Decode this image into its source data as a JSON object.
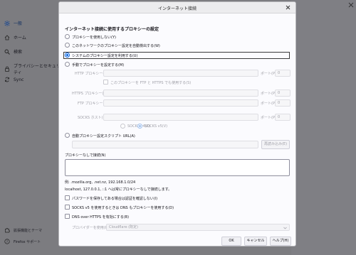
{
  "background": {
    "sidebar": {
      "items": [
        {
          "label": "一般",
          "icon": "gear-icon",
          "active": true
        },
        {
          "label": "ホーム",
          "icon": "home-icon"
        },
        {
          "label": "検索",
          "icon": "search-icon"
        },
        {
          "label": "プライバシーとセキュリティ",
          "icon": "lock-icon"
        },
        {
          "label": "Sync",
          "icon": "sync-icon"
        }
      ],
      "bottom": [
        {
          "label": "拡張機能とテーマ",
          "icon": "puzzle-icon"
        },
        {
          "label": "Firefox サポート",
          "icon": "help-icon"
        }
      ]
    }
  },
  "dialog": {
    "title": "インターネット接続",
    "heading": "インターネット接続に使用するプロキシーの設定",
    "options": {
      "none": "プロキシーを使用しない(Y)",
      "auto_detect": "このネットワークのプロキシー設定を自動検出する(W)",
      "system": "システムのプロキシー設定を利用する(U)",
      "manual": "手動でプロキシーを設定する(M)",
      "auto_url": "自動プロキシー設定スクリプト URL(A)"
    },
    "selected": "system",
    "manual": {
      "http_label": "HTTP プロキシー(X)",
      "port_label": "ポート(P)",
      "http_port": "0",
      "also_ftp_https": "このプロキシーを FTP と HTTPS でも使用する(S)",
      "https_label": "HTTPS プロキシー(H)",
      "https_port": "0",
      "ftp_label": "FTP プロキシー(F)",
      "ftp_port": "0",
      "socks_label": "SOCKS ホスト(C)",
      "socks_port": "0",
      "socks_v4": "SOCKS v4(K)",
      "socks_v5": "SOCKS v5(V)"
    },
    "reload_button": "再読み込み(E)",
    "no_proxy_label": "プロキシーなしで接続(N)",
    "no_proxy_example": "例: .mozilla.org, .net.nz, 192.168.1.0/24",
    "no_proxy_note": "localhost, 127.0.0.1, ::1 へは常にプロキシーなしで接続します。",
    "checkboxes": {
      "no_prompt_auth": "パスワードを保存してある場合は認証を確認しない(I)",
      "socks_dns": "SOCKS v5 を使用するときは DNS もプロキシーを使用する(D)",
      "doh": "DNS over HTTPS を有効にする(B)"
    },
    "provider_label": "プロバイダーを使用(R)",
    "provider_value": "Cloudflare (既定)",
    "buttons": {
      "ok": "OK",
      "cancel": "キャンセル",
      "help": "ヘルプ(H)"
    }
  }
}
